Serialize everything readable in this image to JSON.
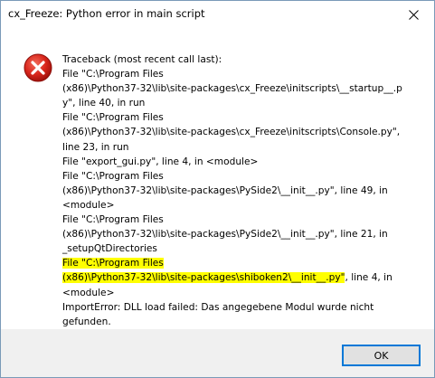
{
  "window": {
    "title": "cx_Freeze: Python error in main script",
    "close_glyph": "✕"
  },
  "icon": {
    "name": "error-icon",
    "color": "#d9261c"
  },
  "message": {
    "lines": [
      {
        "text": "Traceback (most recent call last):",
        "highlight": false
      },
      {
        "text": "  File \"C:\\Program Files",
        "highlight": false
      },
      {
        "text": "(x86)\\Python37-32\\lib\\site-packages\\cx_Freeze\\initscripts\\__startup__.p",
        "highlight": false
      },
      {
        "text": "y\", line 40, in run",
        "highlight": false
      },
      {
        "text": "  File \"C:\\Program Files",
        "highlight": false
      },
      {
        "text": "(x86)\\Python37-32\\lib\\site-packages\\cx_Freeze\\initscripts\\Console.py\",",
        "highlight": false
      },
      {
        "text": "line 23, in run",
        "highlight": false
      },
      {
        "text": "  File \"export_gui.py\", line 4, in <module>",
        "highlight": false
      },
      {
        "text": "  File \"C:\\Program Files",
        "highlight": false
      },
      {
        "text": "(x86)\\Python37-32\\lib\\site-packages\\PySide2\\__init__.py\", line 49, in",
        "highlight": false
      },
      {
        "text": "<module>",
        "highlight": false
      },
      {
        "text": "  File \"C:\\Program Files",
        "highlight": false
      },
      {
        "text": "(x86)\\Python37-32\\lib\\site-packages\\PySide2\\__init__.py\", line 21, in",
        "highlight": false
      },
      {
        "text": "_setupQtDirectories",
        "highlight": false
      },
      {
        "text": "  File \"C:\\Program Files",
        "highlight": true,
        "rest": ""
      },
      {
        "text": "(x86)\\Python37-32\\lib\\site-packages\\shiboken2\\__init__.py\"",
        "highlight": true,
        "rest": ", line 4, in"
      },
      {
        "text": "<module>",
        "highlight": false
      },
      {
        "text": "ImportError: DLL load failed: Das angegebene Modul wurde nicht",
        "highlight": false
      },
      {
        "text": "gefunden.",
        "highlight": false
      }
    ],
    "highlight_color": "#ffff00"
  },
  "footer": {
    "ok_label": "OK"
  }
}
